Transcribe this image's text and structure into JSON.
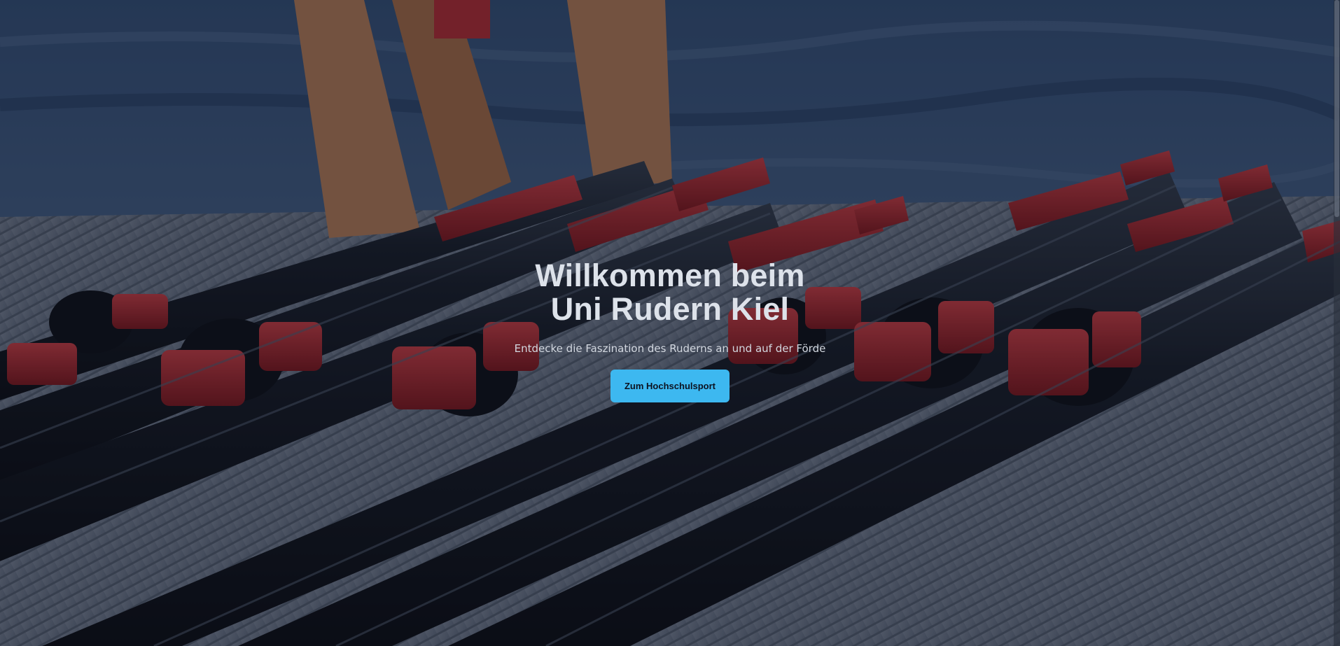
{
  "hero": {
    "title_line1": "Willkommen beim",
    "title_line2": "Uni Rudern Kiel",
    "subtitle": "Entdecke die Faszination des Ruderns an und auf der Förde",
    "cta_label": "Zum Hochschulsport"
  },
  "background": {
    "description_icon": "rowing-oars-photo"
  },
  "colors": {
    "accent": "#3db8f0",
    "oar_red": "#b8222a",
    "oar_black": "#10141c"
  }
}
